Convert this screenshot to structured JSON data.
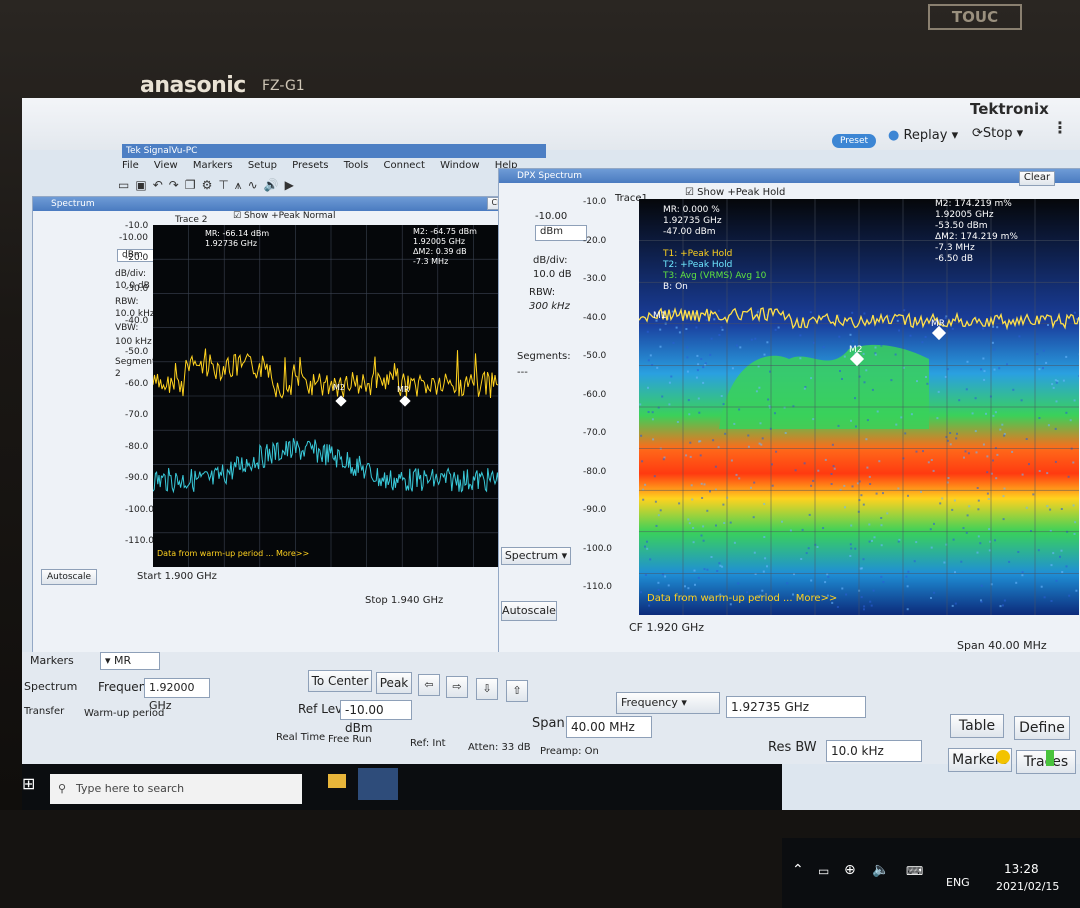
{
  "device": {
    "brand": "anasonic",
    "model": "FZ-G1",
    "touch": "TOUC"
  },
  "app": {
    "title": "Tek SignalVu-PC",
    "vendor": "Tektronix",
    "preset": "Preset",
    "replay": "Replay",
    "stop": "Stop",
    "menu": [
      "File",
      "View",
      "Markers",
      "Setup",
      "Presets",
      "Tools",
      "Connect",
      "Window",
      "Help"
    ]
  },
  "spectrum": {
    "title": "Spectrum",
    "clear": "Clear",
    "trace": "Trace 2",
    "show": "Show",
    "trace_mode": "+Peak Normal",
    "ref_level": "-10.00",
    "unit": "dBm",
    "db_div_label": "dB/div:",
    "db_div": "10.0 dB",
    "rbw_label": "RBW:",
    "rbw": "10.0 kHz",
    "vbw_label": "VBW:",
    "vbw": "100 kHz",
    "segments_label": "Segments:",
    "segments": "2",
    "y_ticks": [
      "-10.0",
      "-20.0",
      "-30.0",
      "-40.0",
      "-50.0",
      "-60.0",
      "-70.0",
      "-80.0",
      "-90.0",
      "-100.0",
      "-110.0"
    ],
    "mr_readout": [
      "MR: -66.14 dBm",
      "1.92736 GHz"
    ],
    "m2_readout": [
      "M2: -64.75 dBm",
      "1.92005 GHz",
      "ΔM2: 0.39 dB",
      "-7.3 MHz"
    ],
    "marker_m2": "M2",
    "marker_mr": "MR",
    "warmup": "Data from warm-up period ... More>>",
    "start": "Start  1.900 GHz",
    "stop_freq": "Stop  1.940 GHz",
    "autoscale": "Autoscale"
  },
  "dpx": {
    "title": "DPX Spectrum",
    "clear": "Clear",
    "trace": "Trace1",
    "show": "Show",
    "trace_mode": "+Peak Hold",
    "ref_level": "-10.00",
    "unit": "dBm",
    "db_div_label": "dB/div:",
    "db_div": "10.0 dB",
    "rbw_label": "RBW:",
    "rbw": "300 kHz",
    "segments_label": "Segments:",
    "segments": "---",
    "y_ticks": [
      "-10.0",
      "-20.0",
      "-30.0",
      "-40.0",
      "-50.0",
      "-60.0",
      "-70.0",
      "-80.0",
      "-90.0",
      "-100.0",
      "-110.0"
    ],
    "mr_readout": [
      "MR: 0.000 %",
      "1.92735 GHz",
      "-47.00 dBm"
    ],
    "traces": [
      "T1: +Peak Hold",
      "T2: +Peak Hold",
      "T3: Avg (VRMS) Avg 10",
      "B: On"
    ],
    "m2_readout": [
      "M2: 174.219 m%",
      "1.92005 GHz",
      "-53.50 dBm",
      "ΔM2: 174.219 m%",
      "-7.3 MHz",
      "-6.50 dB"
    ],
    "marker_m1": "M1",
    "marker_m2": "M2",
    "marker_mr": "MR",
    "warmup": "Data from warm-up period ... More>>",
    "cf": "CF  1.920 GHz",
    "span": "Span  40.00 MHz",
    "autoscale": "Autoscale",
    "mode_select": "Spectrum"
  },
  "controls": {
    "markers_label": "Markers",
    "marker_select": "MR",
    "spectrum_label": "Spectrum",
    "transfer_label": "Transfer",
    "frequency_label": "Frequency",
    "frequency_value": "1.92000 GHz",
    "to_center": "To Center",
    "peak": "Peak",
    "ref_lev_label": "Ref Lev",
    "ref_lev_value": "-10.00 dBm",
    "freq_select": "Frequency",
    "freq_field": "1.92735 GHz",
    "span_label": "Span",
    "span_value": "40.00 MHz",
    "res_bw_label": "Res BW",
    "res_bw_value": "10.0 kHz",
    "table": "Table",
    "define": "Define",
    "markers_btn": "Markers",
    "traces_btn": "Traces"
  },
  "status": {
    "warmup": "Warm-up period",
    "realtime": "Real Time",
    "freerun": "Free Run",
    "ref": "Ref: Int",
    "atten": "Atten: 33 dB",
    "preamp": "Preamp: On"
  },
  "taskbar": {
    "search_placeholder": "Type here to search",
    "lang": "ENG",
    "time": "13:28",
    "date": "2021/02/15"
  }
}
